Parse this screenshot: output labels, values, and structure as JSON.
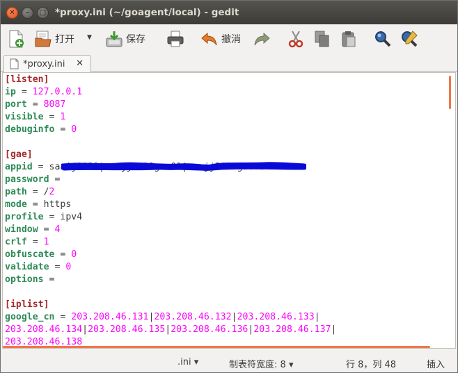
{
  "window": {
    "title": "*proxy.ini (~/goagent/local) - gedit",
    "close_glyph": "✕",
    "min_glyph": "–",
    "max_glyph": "□"
  },
  "toolbar": {
    "open_label": "打开",
    "save_label": "保存",
    "undo_label": "撤消",
    "dropdown_glyph": "▼"
  },
  "tab": {
    "label": "*proxy.ini",
    "close_glyph": "✕"
  },
  "editor": {
    "lines": [
      {
        "section": "[listen]"
      },
      {
        "key": "ip",
        "value": "127.0.0.1",
        "vtype": "num"
      },
      {
        "key": "port",
        "value": "8087",
        "vtype": "num"
      },
      {
        "key": "visible",
        "value": "1",
        "vtype": "num"
      },
      {
        "key": "debuginfo",
        "value": "0",
        "vtype": "num"
      },
      {
        "blank": true
      },
      {
        "section": "[gae]"
      },
      {
        "key": "appid",
        "value": "saaij1029|saajj1029gae01|saajj1029gae02",
        "vtype": "str"
      },
      {
        "key": "password",
        "value": "",
        "vtype": "str"
      },
      {
        "key": "path",
        "value": "/2",
        "vtype": "mixed"
      },
      {
        "key": "mode",
        "value": "https",
        "vtype": "str"
      },
      {
        "key": "profile",
        "value": "ipv4",
        "vtype": "str"
      },
      {
        "key": "window",
        "value": "4",
        "vtype": "num"
      },
      {
        "key": "crlf",
        "value": "1",
        "vtype": "num"
      },
      {
        "key": "obfuscate",
        "value": "0",
        "vtype": "num"
      },
      {
        "key": "validate",
        "value": "0",
        "vtype": "num"
      },
      {
        "key": "options",
        "value": "",
        "vtype": "str"
      },
      {
        "blank": true
      },
      {
        "section": "[iplist]"
      },
      {
        "key": "google_cn",
        "value": "203.208.46.131|203.208.46.132|203.208.46.133|",
        "vtype": "ips"
      },
      {
        "cont": "203.208.46.134|203.208.46.135|203.208.46.136|203.208.46.137|"
      },
      {
        "cont": "203.208.46.138"
      }
    ]
  },
  "status": {
    "filetype": ".ini",
    "tabwidth": "制表符宽度: 8",
    "position": "行 8，列 48",
    "mode": "插入",
    "dropdown_glyph": "▾"
  },
  "colors": {
    "section": "#a52a2a",
    "key": "#2e8b57",
    "number": "#ff00ff",
    "scribble": "#0a0ad8",
    "scrollbar": "#f07746"
  }
}
